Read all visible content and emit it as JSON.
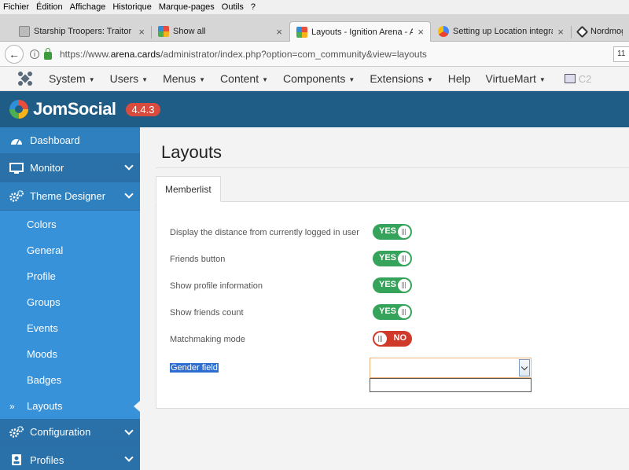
{
  "browser": {
    "menu": [
      "Fichier",
      "Édition",
      "Affichage",
      "Historique",
      "Marque-pages",
      "Outils",
      "?"
    ],
    "tabs": [
      {
        "title": "Starship Troopers: Traitor O",
        "active": false
      },
      {
        "title": "Show all",
        "active": false
      },
      {
        "title": "Layouts - Ignition Arena - A",
        "active": true
      },
      {
        "title": "Setting up Location integrat",
        "active": false
      },
      {
        "title": "Nordmogr",
        "active": false
      }
    ],
    "url_prefix": "https://www.",
    "url_host": "arena.cards",
    "url_path": "/administrator/index.php?option=com_community&view=layouts",
    "zoom_label": "11"
  },
  "admin_menu": {
    "items": [
      "System",
      "Users",
      "Menus",
      "Content",
      "Components",
      "Extensions",
      "Help",
      "VirtueMart"
    ],
    "extra": "C2"
  },
  "header": {
    "brand": "JomSocial",
    "version": "4.4.3"
  },
  "sidebar": {
    "items": [
      {
        "label": "Dashboard"
      },
      {
        "label": "Monitor"
      },
      {
        "label": "Theme Designer"
      }
    ],
    "subitems": [
      "Colors",
      "General",
      "Profile",
      "Groups",
      "Events",
      "Moods",
      "Badges",
      "Layouts"
    ],
    "bottom_items": [
      {
        "label": "Configuration"
      },
      {
        "label": "Profiles"
      }
    ]
  },
  "main": {
    "title": "Layouts",
    "tab": "Memberlist",
    "settings": [
      {
        "label": "Display the distance from currently logged in user",
        "state": "YES"
      },
      {
        "label": "Friends button",
        "state": "YES"
      },
      {
        "label": "Show profile information",
        "state": "YES"
      },
      {
        "label": "Show friends count",
        "state": "YES"
      },
      {
        "label": "Matchmaking mode",
        "state": "NO"
      }
    ],
    "gender_label": "Gender field",
    "gender_value": ""
  },
  "colors": {
    "header_bg": "#1f5d86",
    "sidebar_bg": "#2f80bf",
    "toggle_yes": "#36a35a",
    "toggle_no": "#cf3a2b",
    "version_badge": "#d94c3d"
  }
}
